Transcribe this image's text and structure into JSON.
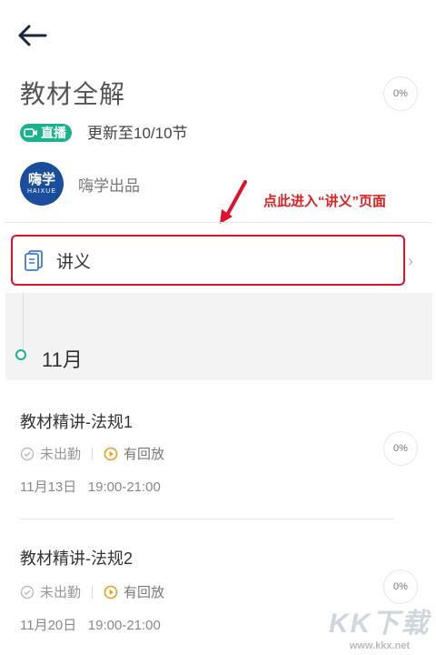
{
  "course": {
    "title": "教材全解",
    "progress": "0%",
    "live_badge": "直播",
    "updated_text": "更新至10/10节",
    "producer_logo_text": "嗨学",
    "producer_logo_sub": "HAIXUE",
    "producer": "嗨学出品"
  },
  "annotation": "点此进入“讲义”页面",
  "handout": {
    "label": "讲义"
  },
  "timeline": {
    "month": "11月"
  },
  "lessons": [
    {
      "title": "教材精讲-法规1",
      "attendance": "未出勤",
      "replay": "有回放",
      "date": "11月13日",
      "time": "19:00-21:00",
      "progress": "0%"
    },
    {
      "title": "教材精讲-法规2",
      "attendance": "未出勤",
      "replay": "有回放",
      "date": "11月20日",
      "time": "19:00-21:00",
      "progress": "0%"
    }
  ],
  "watermark": {
    "text": "KK下载",
    "url": "www.kkx.net"
  },
  "colors": {
    "accent": "#19b28b",
    "annotation_red": "#e0102a"
  }
}
